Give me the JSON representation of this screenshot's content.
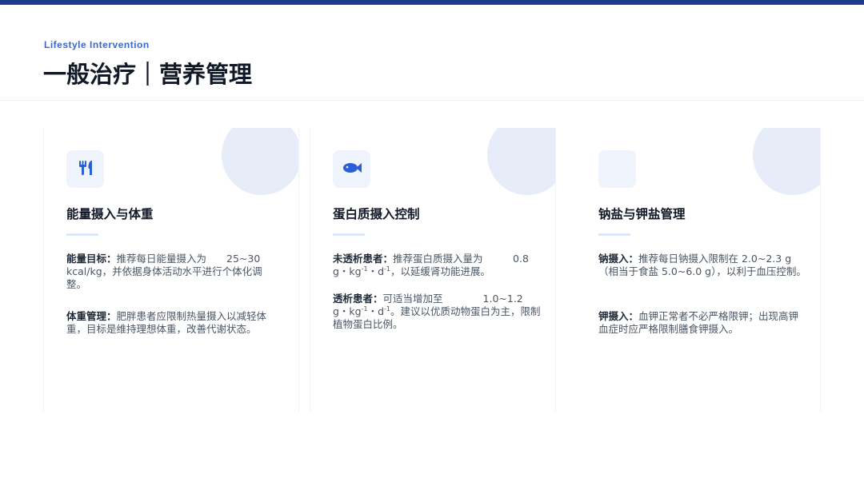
{
  "header": {
    "eyebrow": "Lifestyle Intervention",
    "title": "一般治疗｜营养管理"
  },
  "cards": [
    {
      "icon": "utensils-icon",
      "title": "能量摄入与体重",
      "paragraphs": [
        {
          "label": "能量目标：",
          "text": "推荐每日能量摄入为　　25~30 kcal/kg，并依据身体活动水平进行个体化调整。"
        },
        {
          "label": "体重管理：",
          "text": "肥胖患者应限制热量摄入以减轻体重，目标是维持理想体重，改善代谢状态。"
        }
      ]
    },
    {
      "icon": "fish-icon",
      "title": "蛋白质摄入控制",
      "paragraphs": [
        {
          "label": "未透析患者：",
          "text_before": "推荐蛋白质摄入量为　　　0.8 g・kg",
          "sup1": "-1",
          "text_mid": "・d",
          "sup2": "-1",
          "text_after": "，以延缓肾功能进展。"
        },
        {
          "label": "透析患者：",
          "text_before": "可适当增加至　　　　1.0~1.2 g・kg",
          "sup1": "-1",
          "text_mid": "・d",
          "sup2": "-1",
          "text_after": "。建议以优质动物蛋白为主，限制植物蛋白比例。"
        }
      ]
    },
    {
      "icon": "salt-icon",
      "title": "钠盐与钾盐管理",
      "paragraphs": [
        {
          "label": "钠摄入：",
          "text": "推荐每日钠摄入限制在 2.0~2.3 g（相当于食盐 5.0~6.0 g），以利于血压控制。"
        },
        {
          "label": "钾摄入：",
          "text": "血钾正常者不必严格限钾；出现高钾血症时应严格限制膳食钾摄入。"
        }
      ]
    }
  ],
  "colors": {
    "accent": "#1e3a8a",
    "eyebrow": "#3b67c9",
    "icon": "#2b5fd6",
    "circle": "#e6edf9"
  }
}
